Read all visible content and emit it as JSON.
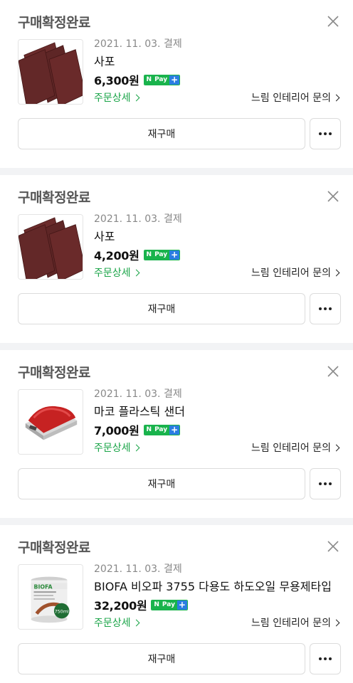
{
  "orders": [
    {
      "status": "구매확정완료",
      "date": "2021. 11. 03. 결제",
      "product_name": "사포",
      "price": "6,300원",
      "thumb": "sandpaper",
      "detail_link": "주문상세",
      "seller_link": "느림 인테리어 문의",
      "rebuy_label": "재구매"
    },
    {
      "status": "구매확정완료",
      "date": "2021. 11. 03. 결제",
      "product_name": "사포",
      "price": "4,200원",
      "thumb": "sandpaper",
      "detail_link": "주문상세",
      "seller_link": "느림 인테리어 문의",
      "rebuy_label": "재구매"
    },
    {
      "status": "구매확정완료",
      "date": "2021. 11. 03. 결제",
      "product_name": "마코 플라스틱 샌더",
      "price": "7,000원",
      "thumb": "sander",
      "detail_link": "주문상세",
      "seller_link": "느림 인테리어 문의",
      "rebuy_label": "재구매"
    },
    {
      "status": "구매확정완료",
      "date": "2021. 11. 03. 결제",
      "product_name": "BIOFA 비오파 3755 다용도 하도오일 무용제타입",
      "price": "32,200원",
      "thumb": "oil-can",
      "thumb_texts": {
        "brand": "BIOFA",
        "volume": "750ml"
      },
      "detail_link": "주문상세",
      "seller_link": "느림 인테리어 문의",
      "rebuy_label": "재구매"
    }
  ],
  "npay_badge": {
    "n": "N",
    "pay": "Pay",
    "plus": "+"
  },
  "colors": {
    "accent_green": "#19a447",
    "npay_green": "#19b34c",
    "npay_blue": "#2a7de1"
  },
  "icons": {
    "close": "close-icon",
    "more": "more-dots-icon",
    "chevron": "chevron-right-icon"
  }
}
